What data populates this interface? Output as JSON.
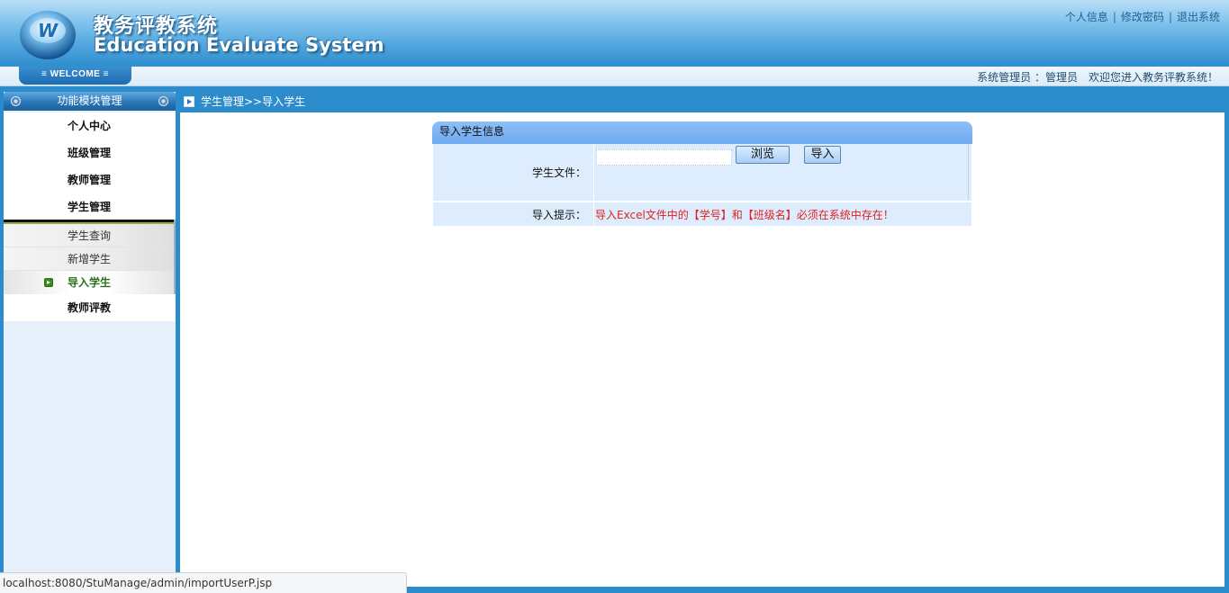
{
  "header": {
    "title_cn": "教务评教系统",
    "title_en": "Education Evaluate System",
    "logo_letter": "W",
    "links": [
      "个人信息",
      "修改密码",
      "退出系统"
    ],
    "link_separator": "|"
  },
  "welcome_bar": {
    "tab_label": "≡ WELCOME ≡",
    "role": "系统管理员 ：管理员",
    "greeting": "欢迎您进入教务评教系统！"
  },
  "sidebar": {
    "title": "功能模块管理",
    "groups": [
      {
        "label": "个人中心"
      },
      {
        "label": "班级管理"
      },
      {
        "label": "教师管理"
      },
      {
        "label": "学生管理"
      },
      {
        "label": "教师评教"
      }
    ],
    "student_submenu": [
      {
        "label": "学生查询",
        "active": false
      },
      {
        "label": "新增学生",
        "active": false
      },
      {
        "label": "导入学生",
        "active": true
      }
    ]
  },
  "breadcrumb": "学生管理>>导入学生",
  "panel": {
    "title": "导入学生信息",
    "file_label": "学生文件：",
    "file_value": "",
    "browse_button": "浏览",
    "import_button": "导入",
    "hint_label": "导入提示：",
    "hint_text": "导入Excel文件中的【学号】和【班级名】必须在系统中存在！"
  },
  "status_bar": {
    "url": "localhost:8080/StuManage/admin/importUserP.jsp"
  },
  "colors": {
    "frame_blue": "#2b8bcb",
    "hint_red": "#e02020",
    "active_green": "#2b6f1a"
  }
}
